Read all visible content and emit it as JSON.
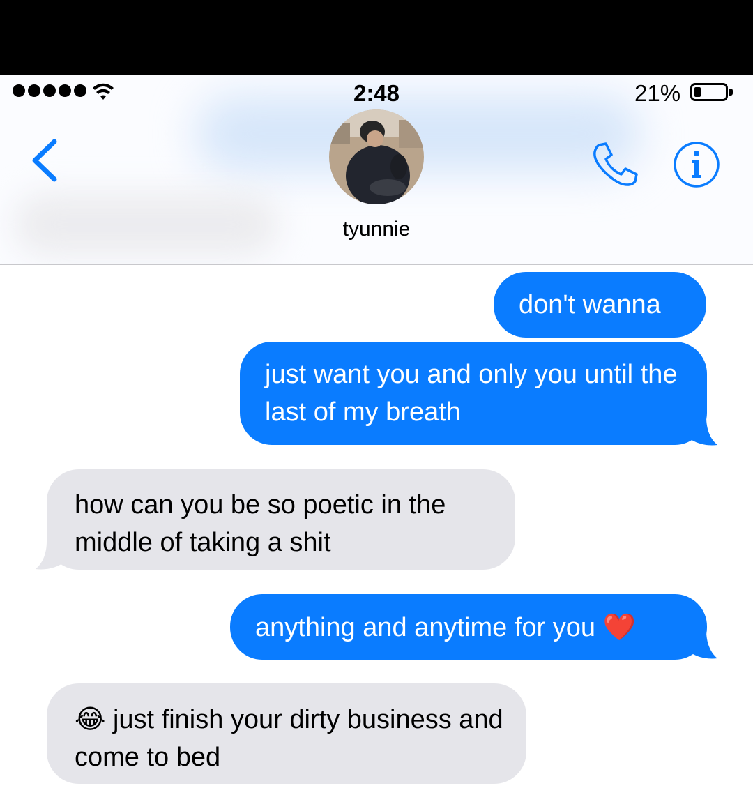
{
  "status_bar": {
    "time": "2:48",
    "battery_percent": "21%",
    "battery_level": 0.21,
    "signal_bars": 5
  },
  "header": {
    "contact_name": "tyunnie",
    "back_icon": "chevron-left-icon",
    "call_icon": "phone-icon",
    "info_icon": "info-icon",
    "accent_color": "#0a7cff"
  },
  "messages": [
    {
      "direction": "sent",
      "text": "don't wanna"
    },
    {
      "direction": "sent",
      "text": "just want you and only you until the last of my breath"
    },
    {
      "direction": "received",
      "text": "how can you be so poetic in the middle of taking a shit"
    },
    {
      "direction": "sent",
      "text": "anything and anytime for you",
      "emoji_after": "❤️"
    },
    {
      "direction": "received",
      "text": "just finish your dirty business and come to bed",
      "emoji_before": "😂"
    }
  ],
  "colors": {
    "sent_bubble": "#0a7cff",
    "received_bubble": "#e5e5ea"
  }
}
